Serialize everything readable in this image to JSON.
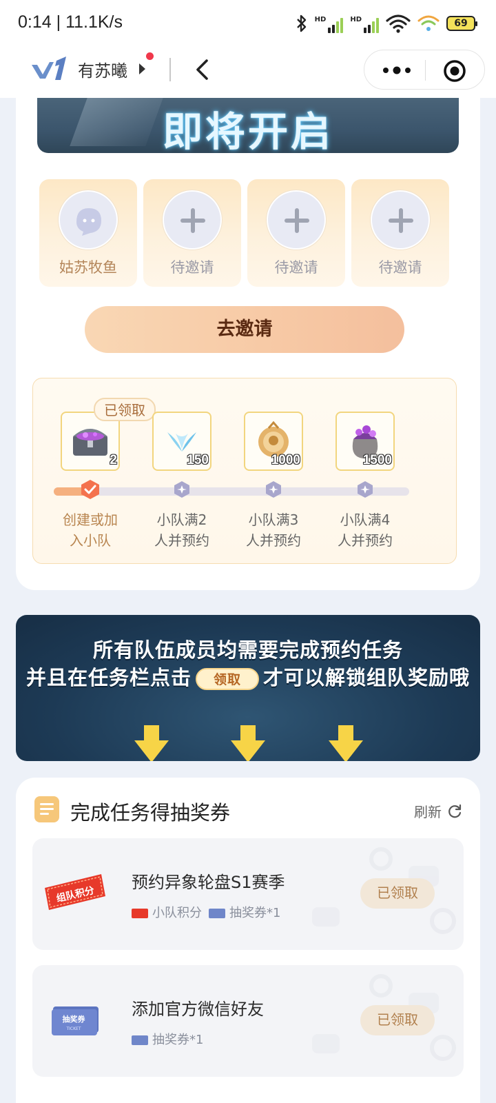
{
  "status_bar": {
    "time": "0:14",
    "net_speed": "11.1K/s",
    "network_label": "HD",
    "battery": "69"
  },
  "nav": {
    "app_name": "有苏曦"
  },
  "banner": {
    "text": "即将开启"
  },
  "team": {
    "slots": [
      {
        "label": "姑苏牧鱼",
        "state": "member"
      },
      {
        "label": "待邀请",
        "state": "empty"
      },
      {
        "label": "待邀请",
        "state": "empty"
      },
      {
        "label": "待邀请",
        "state": "empty"
      }
    ],
    "invite_button": "去邀请"
  },
  "rewards": {
    "claimed_tag": "已领取",
    "items": [
      {
        "count": "2",
        "icon": "treasure-chest-icon"
      },
      {
        "count": "150",
        "icon": "crystal-icon"
      },
      {
        "count": "1000",
        "icon": "gold-medal-icon"
      },
      {
        "count": "1500",
        "icon": "gem-bag-icon"
      }
    ],
    "stages": [
      {
        "line1": "创建或加",
        "line2": "入小队",
        "done": true
      },
      {
        "line1": "小队满2",
        "line2": "人并预约",
        "done": false
      },
      {
        "line1": "小队满3",
        "line2": "人并预约",
        "done": false
      },
      {
        "line1": "小队满4",
        "line2": "人并预约",
        "done": false
      }
    ]
  },
  "notice": {
    "line1": "所有队伍成员均需要完成预约任务",
    "line2_before": "并且在任务栏点击",
    "line2_pill": "领取",
    "line2_after": "才可以解锁组队奖励哦"
  },
  "tasks": {
    "title": "完成任务得抽奖券",
    "refresh_label": "刷新",
    "items": [
      {
        "badge_text": "组队积分",
        "name": "预约异象轮盘S1赛季",
        "reward1": "小队积分",
        "reward2": "抽奖券*1",
        "button": "已领取"
      },
      {
        "badge_text": "抽奖券",
        "badge_subtext": "TICKET",
        "name": "添加官方微信好友",
        "reward1": "抽奖券*1",
        "button": "已领取"
      }
    ]
  },
  "colors": {
    "accent_peach": "#f7c9a5",
    "claimed_text": "#b1804e",
    "page_bg": "#edf1f8"
  }
}
